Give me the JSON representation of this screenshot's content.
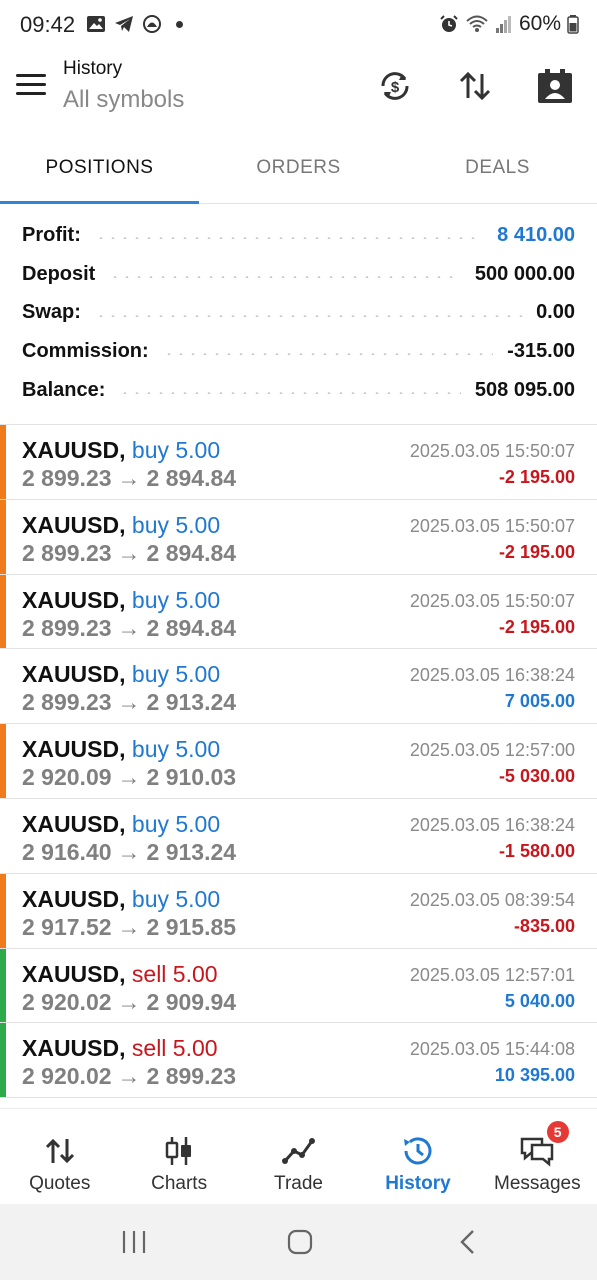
{
  "status_bar": {
    "time": "09:42",
    "battery": "60%",
    "left_icons": [
      "image-icon",
      "telegram-icon",
      "notification-icon"
    ],
    "right_icons": [
      "alarm-icon",
      "wifi-icon",
      "signal-icon",
      "battery-icon"
    ]
  },
  "header": {
    "title": "History",
    "subtitle": "All symbols",
    "actions": [
      "currency-exchange-icon",
      "sort-icon",
      "contact-card-icon"
    ]
  },
  "tabs": [
    {
      "label": "POSITIONS",
      "active": true
    },
    {
      "label": "ORDERS",
      "active": false
    },
    {
      "label": "DEALS",
      "active": false
    }
  ],
  "summary": [
    {
      "label": "Profit:",
      "value": "8 410.00",
      "color": "#1f78d1"
    },
    {
      "label": "Deposit",
      "value": "500 000.00",
      "color": "#111111"
    },
    {
      "label": "Swap:",
      "value": "0.00",
      "color": "#111111"
    },
    {
      "label": "Commission:",
      "value": "-315.00",
      "color": "#111111"
    },
    {
      "label": "Balance:",
      "value": "508 095.00",
      "color": "#111111"
    }
  ],
  "deals": [
    {
      "symbol": "XAUUSD,",
      "type": "buy 5.00",
      "side": "buy",
      "open": "2 899.23",
      "close": "2 894.84",
      "time": "2025.03.05 15:50:07",
      "profit": "-2 195.00",
      "bar_color": "#f07b1d"
    },
    {
      "symbol": "XAUUSD,",
      "type": "buy 5.00",
      "side": "buy",
      "open": "2 899.23",
      "close": "2 894.84",
      "time": "2025.03.05 15:50:07",
      "profit": "-2 195.00",
      "bar_color": "#f07b1d"
    },
    {
      "symbol": "XAUUSD,",
      "type": "buy 5.00",
      "side": "buy",
      "open": "2 899.23",
      "close": "2 894.84",
      "time": "2025.03.05 15:50:07",
      "profit": "-2 195.00",
      "bar_color": "#f07b1d"
    },
    {
      "symbol": "XAUUSD,",
      "type": "buy 5.00",
      "side": "buy",
      "open": "2 899.23",
      "close": "2 913.24",
      "time": "2025.03.05 16:38:24",
      "profit": "7 005.00",
      "bar_color": ""
    },
    {
      "symbol": "XAUUSD,",
      "type": "buy 5.00",
      "side": "buy",
      "open": "2 920.09",
      "close": "2 910.03",
      "time": "2025.03.05 12:57:00",
      "profit": "-5 030.00",
      "bar_color": "#f07b1d"
    },
    {
      "symbol": "XAUUSD,",
      "type": "buy 5.00",
      "side": "buy",
      "open": "2 916.40",
      "close": "2 913.24",
      "time": "2025.03.05 16:38:24",
      "profit": "-1 580.00",
      "bar_color": ""
    },
    {
      "symbol": "XAUUSD,",
      "type": "buy 5.00",
      "side": "buy",
      "open": "2 917.52",
      "close": "2 915.85",
      "time": "2025.03.05 08:39:54",
      "profit": "-835.00",
      "bar_color": "#f07b1d"
    },
    {
      "symbol": "XAUUSD,",
      "type": "sell 5.00",
      "side": "sell",
      "open": "2 920.02",
      "close": "2 909.94",
      "time": "2025.03.05 12:57:01",
      "profit": "5 040.00",
      "bar_color": "#2eaa4a"
    },
    {
      "symbol": "XAUUSD,",
      "type": "sell 5.00",
      "side": "sell",
      "open": "2 920.02",
      "close": "2 899.23",
      "time": "2025.03.05 15:44:08",
      "profit": "10 395.00",
      "bar_color": "#2eaa4a"
    }
  ],
  "arrow": "→",
  "bottom_nav": [
    {
      "label": "Quotes",
      "icon": "quotes-icon",
      "active": false
    },
    {
      "label": "Charts",
      "icon": "charts-icon",
      "active": false
    },
    {
      "label": "Trade",
      "icon": "trade-icon",
      "active": false
    },
    {
      "label": "History",
      "icon": "history-icon",
      "active": true
    },
    {
      "label": "Messages",
      "icon": "messages-icon",
      "active": false,
      "badge": "5"
    }
  ],
  "accent_color": "#1f78d1"
}
